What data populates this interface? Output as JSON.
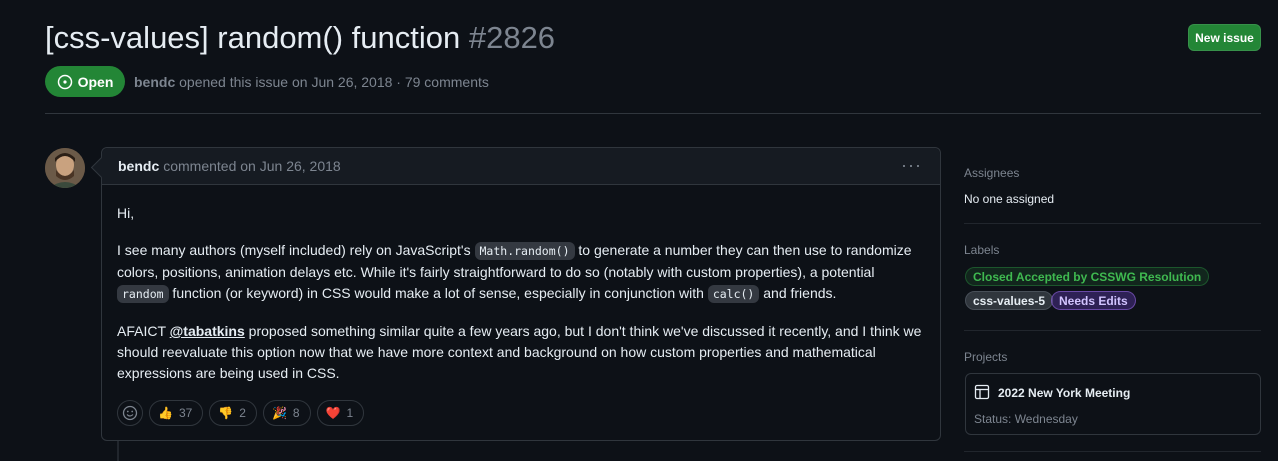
{
  "issue": {
    "title": "[css-values] random() function",
    "number": "#2826",
    "state": "Open",
    "author": "bendc",
    "meta_text": "opened this issue on Jun 26, 2018 · 79 comments"
  },
  "header": {
    "new_issue_label": "New issue"
  },
  "comment": {
    "author": "bendc",
    "meta": "commented on Jun 26, 2018",
    "greeting": "Hi,",
    "p1_a": "I see many authors (myself included) rely on JavaScript's ",
    "p1_code1": "Math.random()",
    "p1_b": " to generate a number they can then use to randomize colors, positions, animation delays etc. While it's fairly straightforward to do so (notably with custom properties), a potential ",
    "p1_code2": "random",
    "p1_c": " function (or keyword) in CSS would make a lot of sense, especially in conjunction with ",
    "p1_code3": "calc()",
    "p1_d": " and friends.",
    "p2_a": "AFAICT ",
    "p2_mention": "@tabatkins",
    "p2_b": " proposed something similar quite a few years ago, but I don't think we've discussed it recently, and I think we should reevaluate this option now that we have more context and background on how custom properties and mathematical expressions are being used in CSS.",
    "reactions": [
      {
        "emoji": "👍",
        "count": "37"
      },
      {
        "emoji": "👎",
        "count": "2"
      },
      {
        "emoji": "🎉",
        "count": "8"
      },
      {
        "emoji": "❤️",
        "count": "1"
      }
    ]
  },
  "sidebar": {
    "assignees_heading": "Assignees",
    "assignees_value": "No one assigned",
    "labels_heading": "Labels",
    "labels": [
      {
        "text": "Closed Accepted by CSSWG Resolution",
        "color": "#3fb950"
      },
      {
        "text": "css-values-5",
        "color": "#e6edf3"
      },
      {
        "text": "Needs Edits",
        "color": "#d2c4ff"
      }
    ],
    "projects_heading": "Projects",
    "project_name": "2022 New York Meeting",
    "project_status": "Status: Wednesday"
  },
  "colors": {
    "accent_green": "#238636",
    "background": "#0d1117",
    "muted": "#7d8590"
  }
}
